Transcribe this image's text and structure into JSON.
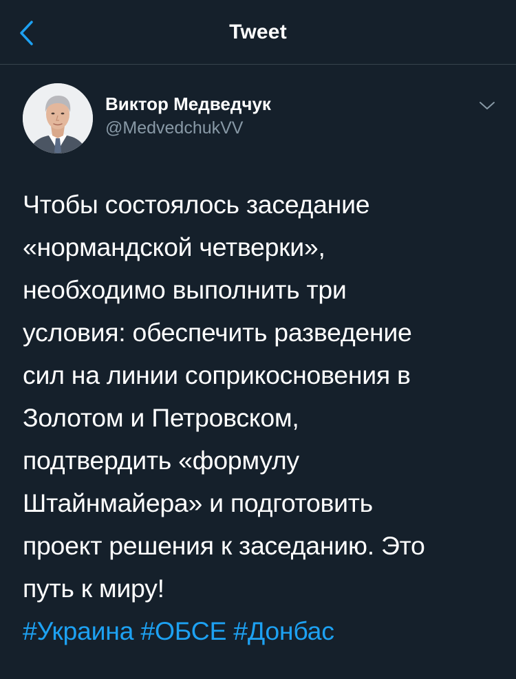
{
  "header": {
    "title": "Tweet",
    "back_icon": "chevron-left-icon"
  },
  "author": {
    "name": "Виктор Медведчук",
    "handle": "@MedvedchukVV",
    "more_icon": "chevron-down-icon"
  },
  "tweet": {
    "lines": [
      "Чтобы состоялось заседание",
      "«нормандской четверки»,",
      "необходимо выполнить три",
      "условия: обеспечить разведение",
      "сил на линии соприкосновения в",
      "Золотом и Петровском,",
      "подтвердить «формулу",
      "Штайнмайера» и подготовить",
      "проект решения к заседанию. Это",
      "путь к миру!"
    ],
    "hashtags": [
      "#Украина",
      "#ОБСЕ",
      "#Донбас"
    ]
  },
  "colors": {
    "background": "#15202b",
    "accent": "#1da1f2",
    "secondary_text": "#8899a6",
    "divider": "#38444d"
  }
}
